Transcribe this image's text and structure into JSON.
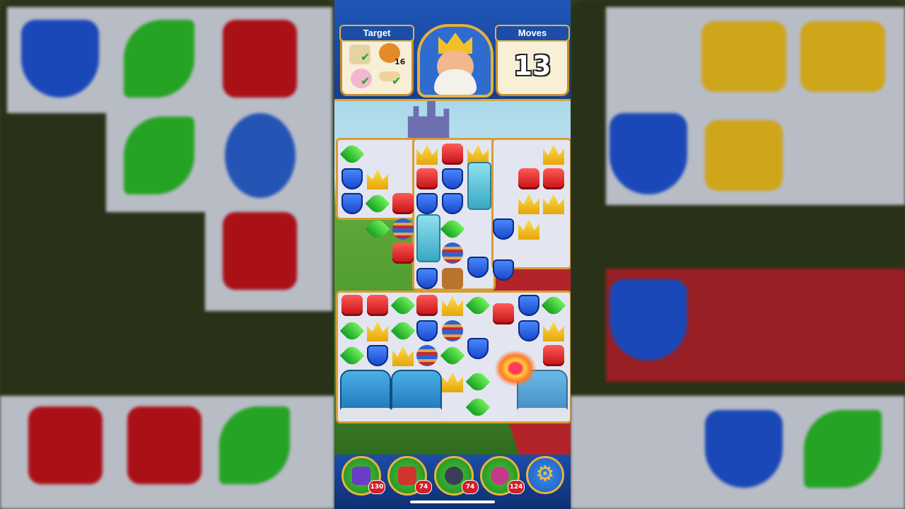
{
  "hud": {
    "target_label": "Target",
    "moves_label": "Moves",
    "moves_value": "13",
    "targets": [
      {
        "name": "scroll-map-icon",
        "done": true
      },
      {
        "name": "teddy-bear-icon",
        "count": "16",
        "done": false
      },
      {
        "name": "easter-egg-icon",
        "done": true
      },
      {
        "name": "bone-icon",
        "done": true
      }
    ]
  },
  "boosters": [
    {
      "name": "hammer-booster",
      "count": "130"
    },
    {
      "name": "arrow-booster",
      "count": "74"
    },
    {
      "name": "cannon-booster",
      "count": "74"
    },
    {
      "name": "jester-booster",
      "count": "124"
    }
  ],
  "colors": {
    "red": "#d81820",
    "blue": "#1f55d8",
    "green": "#2cc02a",
    "crown": "#f3c21e",
    "frame": "#d79c35"
  }
}
